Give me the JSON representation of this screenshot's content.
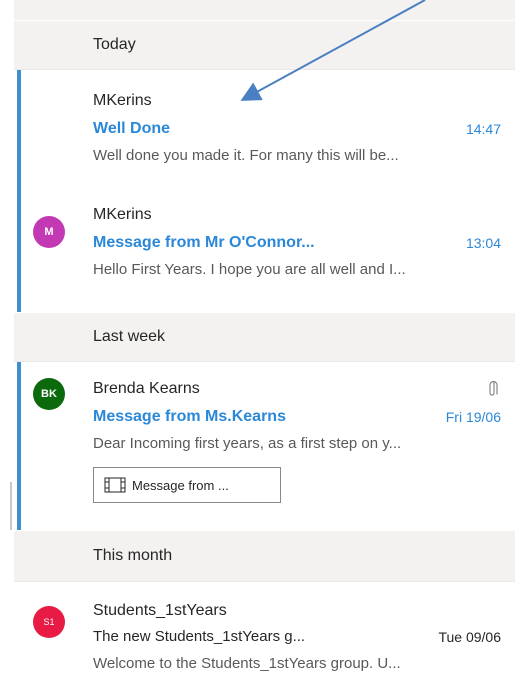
{
  "groups": {
    "today": "Today",
    "last_week": "Last week",
    "this_month": "This month"
  },
  "messages": [
    {
      "sender": "MKerins",
      "subject": "Well Done",
      "time": "14:47",
      "preview": "Well done you made it. For many this will be...",
      "unread": true
    },
    {
      "sender": "MKerins",
      "avatar": "M",
      "avatar_color": "#c239b3",
      "subject": "Message from Mr O'Connor...",
      "time": "13:04",
      "preview": "Hello First Years. I hope you are all well and I...",
      "unread": true
    },
    {
      "sender": "Brenda Kearns",
      "avatar": "BK",
      "avatar_color": "#0b6a0b",
      "subject": "Message from Ms.Kearns",
      "time": "Fri 19/06",
      "preview": "Dear Incoming first years, as a first step on y...",
      "attachment": "Message from ...",
      "has_attachment_icon": true,
      "unread": true
    },
    {
      "sender": "Students_1stYears",
      "avatar": "S1",
      "avatar_color": "#e81b45",
      "subject": "The new Students_1stYears g...",
      "time": "Tue 09/06",
      "preview": "Welcome to the Students_1stYears group. U...",
      "unread": false
    }
  ],
  "colors": {
    "accent": "#2b88d8",
    "unread_bar": "#3e8fcc",
    "group_bg": "#f3f2f1",
    "annotation_arrow": "#4a7fc1"
  }
}
